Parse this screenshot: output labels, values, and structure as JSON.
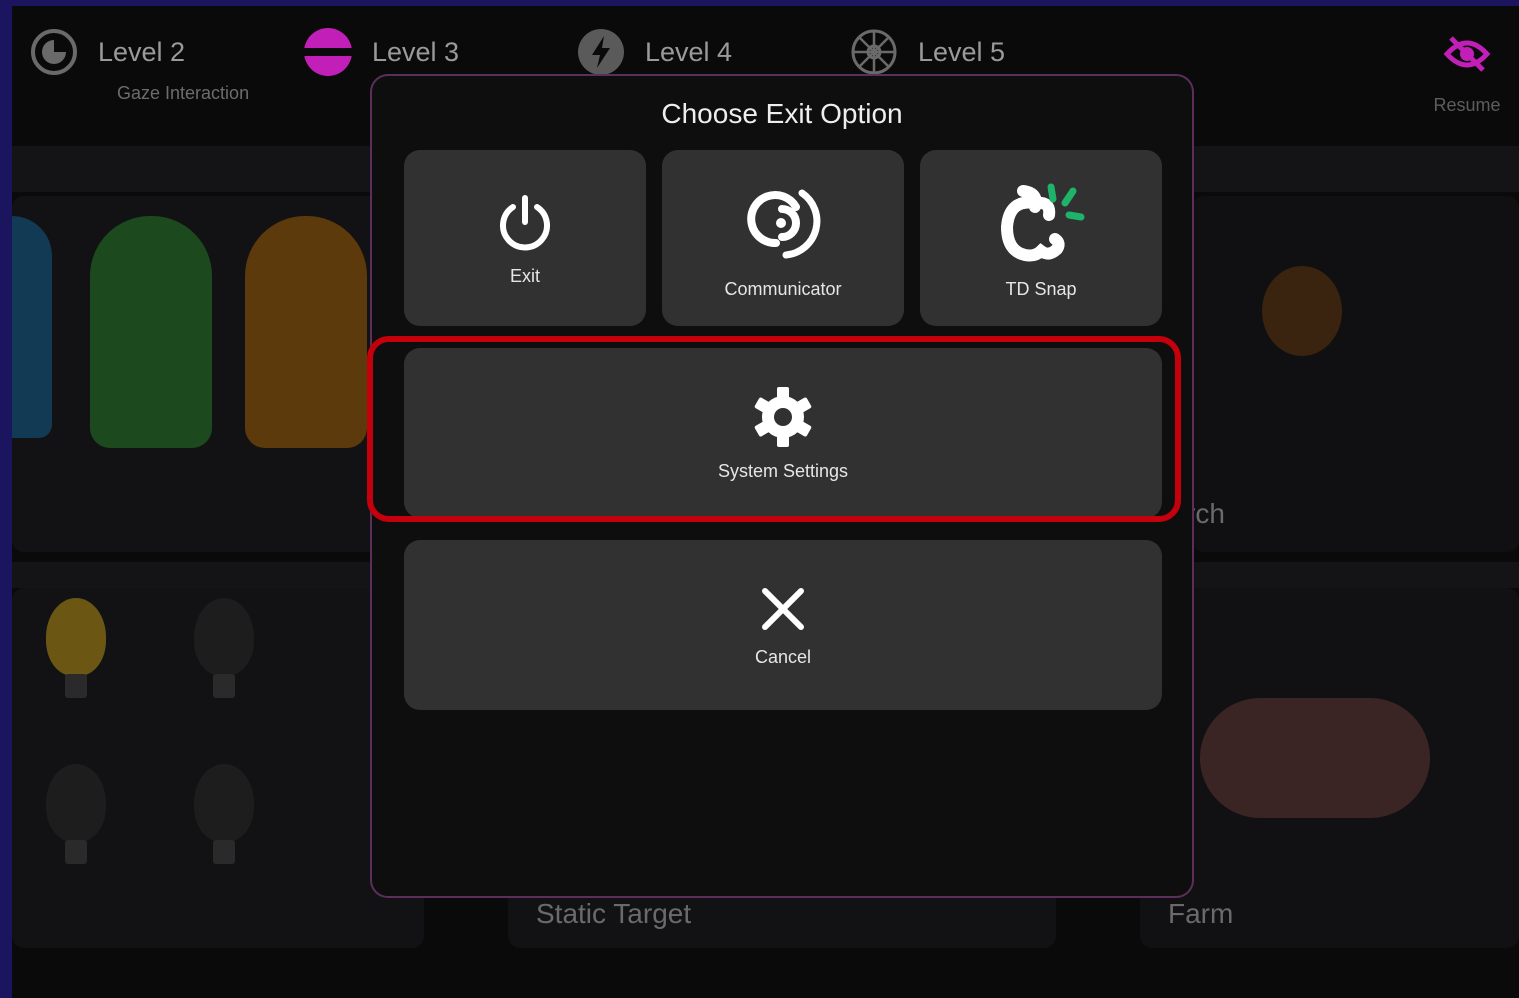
{
  "levels": [
    {
      "title": "Level 2",
      "subtitle": "Gaze Interaction",
      "icon": "gaze-circle-icon"
    },
    {
      "title": "Level 3",
      "icon": "magenta-disc-icon"
    },
    {
      "title": "Level 4",
      "icon": "lightning-icon"
    },
    {
      "title": "Level 5",
      "icon": "wheel-icon"
    }
  ],
  "resume": {
    "label": "Resume",
    "icon": "eye-slash-icon",
    "color": "#c21fb8"
  },
  "background_cards": {
    "row1_right_label_partial": "rch",
    "row2_middle_label": "Static Target",
    "row2_right_label": "Farm"
  },
  "modal": {
    "title": "Choose Exit Option",
    "options": [
      {
        "label": "Exit",
        "icon": "power-icon"
      },
      {
        "label": "Communicator",
        "icon": "communicator-icon"
      },
      {
        "label": "TD Snap",
        "icon": "td-snap-icon"
      },
      {
        "label": "System Settings",
        "icon": "gear-icon",
        "highlighted": true
      },
      {
        "label": "Cancel",
        "icon": "close-icon"
      }
    ]
  },
  "colors": {
    "accent": "#c21fb8",
    "highlight": "#c4000d",
    "snap_green": "#1fb36a"
  }
}
